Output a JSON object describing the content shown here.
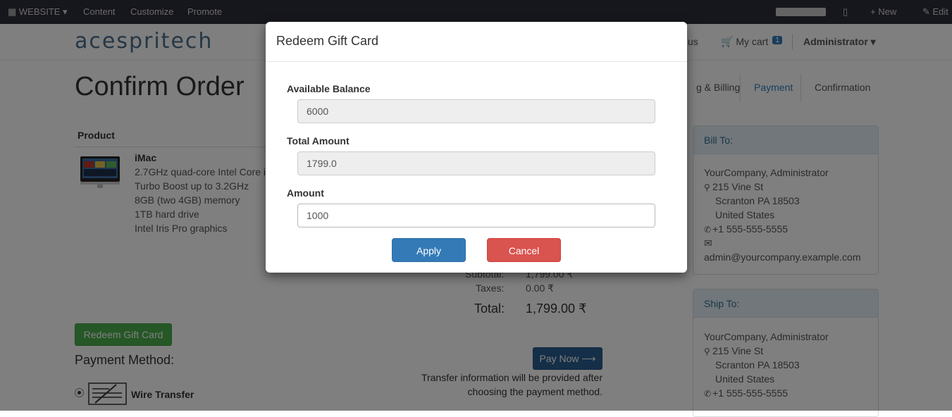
{
  "admin_bar": {
    "website_label": "WEBSITE",
    "content_label": "Content",
    "customize_label": "Customize",
    "promote_label": "Promote",
    "new_label": "New",
    "edit_label": "Edit"
  },
  "navbar": {
    "logo_text": "acespritech",
    "contact_partial": "us",
    "cart_label": "My cart",
    "cart_count": "1",
    "user_label": "Administrator"
  },
  "page": {
    "title": "Confirm Order",
    "steps": [
      "g & Billing",
      "Payment",
      "Confirmation"
    ],
    "product_header": "Product",
    "product": {
      "name": "iMac",
      "description": [
        "2.7GHz quad-core Intel Core i",
        "Turbo Boost up to 3.2GHz",
        "8GB (two 4GB) memory",
        "1TB hard drive",
        "Intel Iris Pro graphics"
      ]
    },
    "summary": {
      "subtotal_label": "Subtotal:",
      "subtotal_value": "1,799.00 ₹",
      "taxes_label": "Taxes:",
      "taxes_value": "0.00 ₹",
      "total_label": "Total:",
      "total_value": "1,799.00 ₹"
    },
    "redeem_button": "Redeem Gift Card",
    "payment_method_title": "Payment Method:",
    "payment_option": "Wire Transfer",
    "pay_now_button": "Pay Now ⟶",
    "transfer_note": "Transfer information will be provided after choosing the payment method."
  },
  "bill_to": {
    "title": "Bill To:",
    "name": "YourCompany, Administrator",
    "street": "215 Vine St",
    "city": "Scranton PA 18503",
    "country": "United States",
    "phone": "+1 555-555-5555",
    "email": "admin@yourcompany.example.com"
  },
  "ship_to": {
    "title": "Ship To:",
    "name": "YourCompany, Administrator",
    "street": "215 Vine St",
    "city": "Scranton PA 18503",
    "country": "United States",
    "phone": "+1 555-555-5555"
  },
  "modal": {
    "title": "Redeem Gift Card",
    "available_balance_label": "Available Balance",
    "available_balance_value": "6000",
    "total_amount_label": "Total Amount",
    "total_amount_value": "1799.0",
    "amount_label": "Amount",
    "amount_value": "1000",
    "apply_button": "Apply",
    "cancel_button": "Cancel"
  },
  "colors": {
    "admin_bar": "#2d2d3a",
    "primary": "#337ab7",
    "danger": "#d9534f",
    "success": "#4cae4c"
  }
}
